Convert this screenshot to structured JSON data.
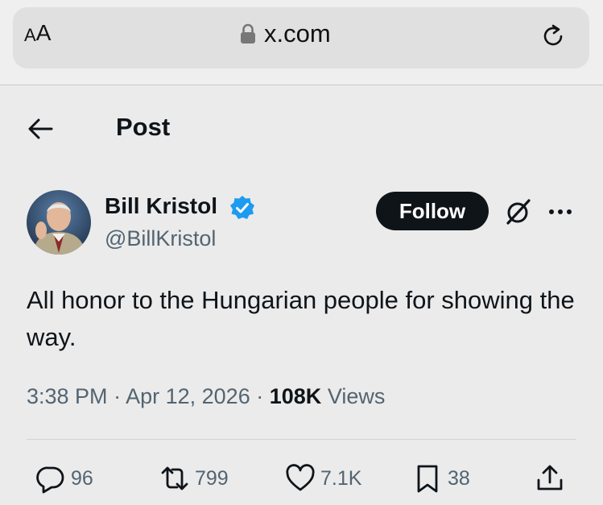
{
  "browser": {
    "aa_small": "A",
    "aa_large": "A",
    "url": "x.com"
  },
  "header": {
    "title": "Post"
  },
  "author": {
    "name": "Bill Kristol",
    "handle": "@BillKristol",
    "follow_label": "Follow"
  },
  "post": {
    "text": "All honor to the Hungarian people for showing the way.",
    "time": "3:38 PM",
    "separator": "·",
    "date": "Apr 12, 2026",
    "views_count": "108K",
    "views_label": "Views"
  },
  "actions": {
    "replies": "96",
    "reposts": "799",
    "likes": "7.1K",
    "bookmarks": "38"
  },
  "colors": {
    "background": "#ebebeb",
    "text_primary": "#0f1419",
    "text_secondary": "#536471",
    "verified": "#1d9bf0",
    "follow_bg": "#0f1419"
  }
}
